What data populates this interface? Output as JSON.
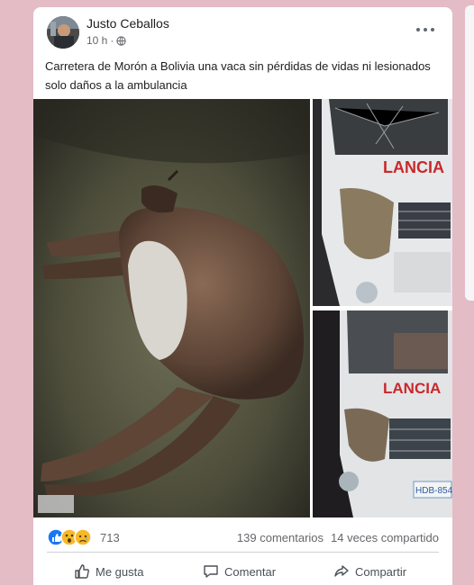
{
  "post": {
    "author": "Justo Ceballos",
    "time": "10 h",
    "caption": "Carretera de Morón a Bolivia una vaca sin pérdidas de vidas ni lesionados solo daños a la ambulancia"
  },
  "stats": {
    "reaction_count": "713",
    "comments": "139 comentarios",
    "shares": "14 veces compartido"
  },
  "actions": {
    "like": "Me gusta",
    "comment": "Comentar",
    "share": "Compartir"
  },
  "photos": {
    "ambulance_text_top": "LANCIA",
    "ambulance_text_bottom": "LANCIA",
    "plate": "HDB-854"
  },
  "colors": {
    "background": "#e3bcc6",
    "card": "#ffffff",
    "secondary_text": "#65676b",
    "like_blue": "#1877f2"
  }
}
